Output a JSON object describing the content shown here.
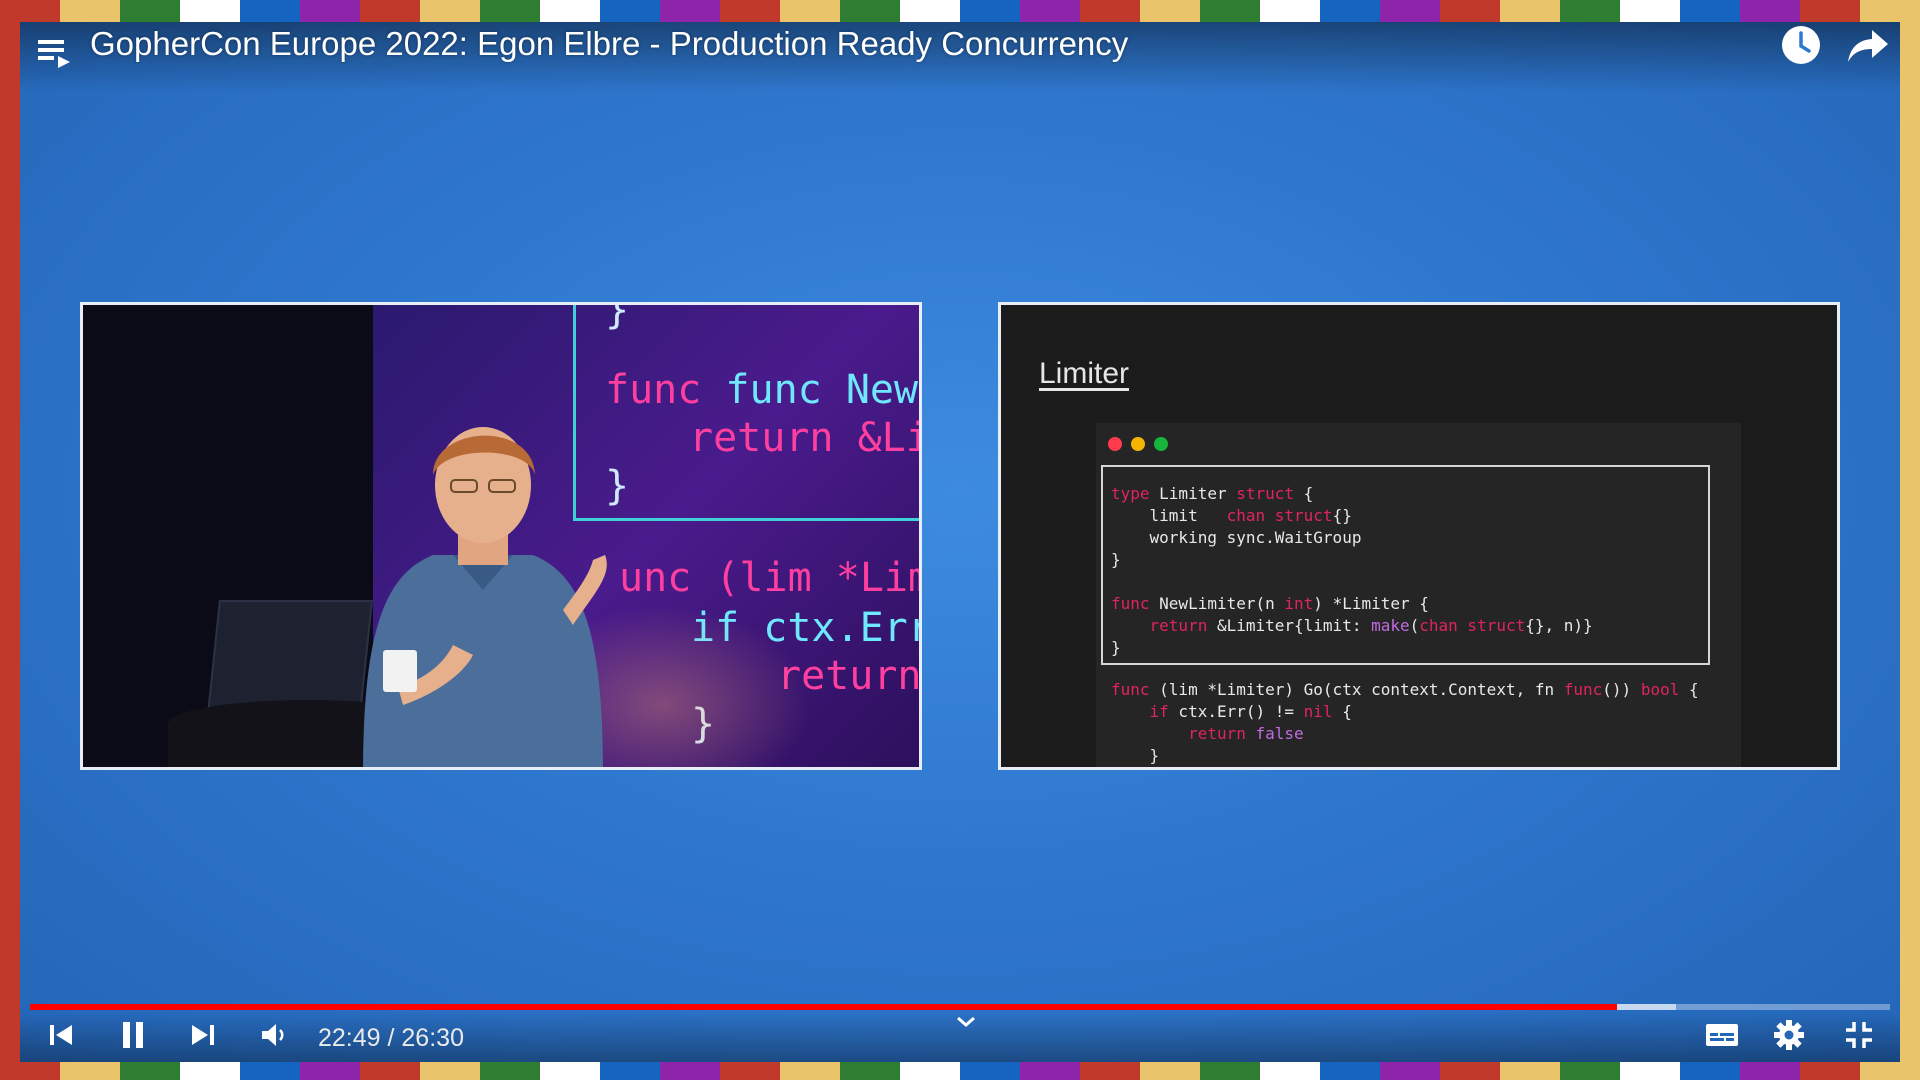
{
  "player": {
    "title": "GopherCon Europe 2022: Egon Elbre - Production Ready Concurrency",
    "time_current": "22:49",
    "time_sep": " / ",
    "time_total": "26:30",
    "progress_fraction": 0.853,
    "buffered_fraction": 0.885,
    "colors": {
      "progress": "#ff0000",
      "background": "#2f78cf"
    }
  },
  "speaker_screen": {
    "lines": [
      "}",
      "func NewLimite",
      "return &Li",
      "}",
      "unc (lim *Lim",
      "if ctx.Err",
      "return",
      "}"
    ]
  },
  "slide": {
    "title": "Limiter",
    "code": {
      "l1_kw1": "type",
      "l1_a": " Limiter ",
      "l1_kw2": "struct",
      "l1_b": " {",
      "l2_a": "    limit   ",
      "l2_kw": "chan struct",
      "l2_b": "{}",
      "l3": "    working sync.WaitGroup",
      "l4": "}",
      "l6_kw": "func",
      "l6_a": " NewLimiter(n ",
      "l6_kw2": "int",
      "l6_b": ") *Limiter {",
      "l7_kw": "    return",
      "l7_a": " &Limiter{limit: ",
      "l7_mk": "make",
      "l7_b": "(",
      "l7_kw2": "chan struct",
      "l7_c": "{}, n)}",
      "l8": "}",
      "l9_kw": "func",
      "l9_a": " (lim *Limiter) Go(ctx context",
      "l9_b": ".Context, fn ",
      "l9_kw2": "func",
      "l9_c": "()) ",
      "l9_kw3": "bool",
      "l9_d": " {",
      "l10_kw": "    if",
      "l10_a": " ctx.Err() != ",
      "l10_kw2": "nil",
      "l10_b": " {",
      "l11_kw": "        return",
      "l11_a": " false",
      "l12": "    }"
    }
  },
  "icons": {
    "playlist": "playlist-icon",
    "watch_later": "clock-icon",
    "share": "share-icon",
    "prev": "skip-previous-icon",
    "pause": "pause-icon",
    "next": "skip-next-icon",
    "volume": "volume-icon",
    "chevron": "chevron-down-icon",
    "subtitles": "subtitles-icon",
    "settings": "gear-icon",
    "exit_fullscreen": "exit-fullscreen-icon"
  }
}
